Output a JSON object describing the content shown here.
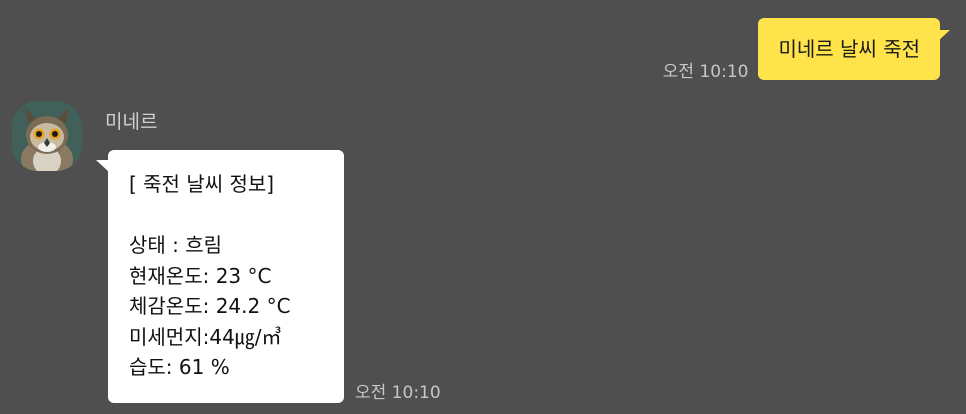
{
  "outgoing": {
    "text": "미네르 날씨 죽전",
    "time": "오전 10:10"
  },
  "incoming": {
    "sender": "미네르",
    "avatar_icon": "owl-avatar",
    "time": "오전 10:10",
    "lines": {
      "title": "[ 죽전 날씨 정보]",
      "status": "상태 : 흐림",
      "current_temp": "현재온도: 23 °C",
      "feels_like": "체감온도: 24.2 °C",
      "fine_dust": "미세먼지:44㎍/㎥",
      "humidity": "습도: 61 %"
    }
  },
  "colors": {
    "background": "#4f4f4f",
    "outgoing_bubble": "#fee34a",
    "incoming_bubble": "#ffffff"
  }
}
